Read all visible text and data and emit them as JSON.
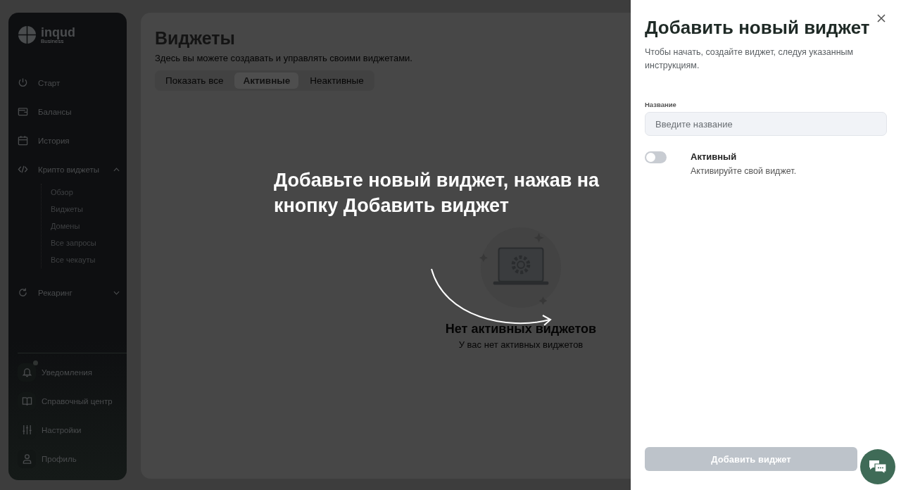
{
  "sidebar": {
    "logo": {
      "name": "inqud",
      "tagline": "Business"
    },
    "items": [
      {
        "label": "Старт"
      },
      {
        "label": "Балансы"
      },
      {
        "label": "История"
      },
      {
        "label": "Крипто виджеты",
        "expanded": true,
        "children": [
          {
            "label": "Обзор"
          },
          {
            "label": "Виджеты"
          },
          {
            "label": "Домены"
          },
          {
            "label": "Все запросы"
          },
          {
            "label": "Все чекауты"
          }
        ]
      },
      {
        "label": "Рекаринг",
        "expanded": false
      }
    ],
    "bottom_items": [
      {
        "label": "Уведомления",
        "badge": true
      },
      {
        "label": "Справочный центр",
        "badge": false
      },
      {
        "label": "Настройки",
        "badge": false
      },
      {
        "label": "Профиль",
        "badge": false
      }
    ]
  },
  "page": {
    "title": "Виджеты",
    "subtitle": "Здесь вы можете создавать и управлять своими виджетами.",
    "tabs": [
      {
        "label": "Показать все",
        "selected": false
      },
      {
        "label": "Активные",
        "selected": true
      },
      {
        "label": "Неактивные",
        "selected": false
      }
    ],
    "empty_state": {
      "title": "Нет активных виджетов",
      "text": "У вас нет активных виджетов"
    }
  },
  "hint": {
    "text": "Добавьте новый виджет, нажав на кнопку Добавить виджет"
  },
  "drawer": {
    "title": "Добавить новый виджет",
    "subtitle": "Чтобы начать, создайте виджет, следуя указанным инструкциям.",
    "field": {
      "label": "Название",
      "placeholder": "Введите название"
    },
    "toggle": {
      "on": false,
      "label": "Активный",
      "description": "Активируйте свой виджет."
    },
    "submit": {
      "label": "Добавить виджет",
      "disabled": true
    }
  }
}
